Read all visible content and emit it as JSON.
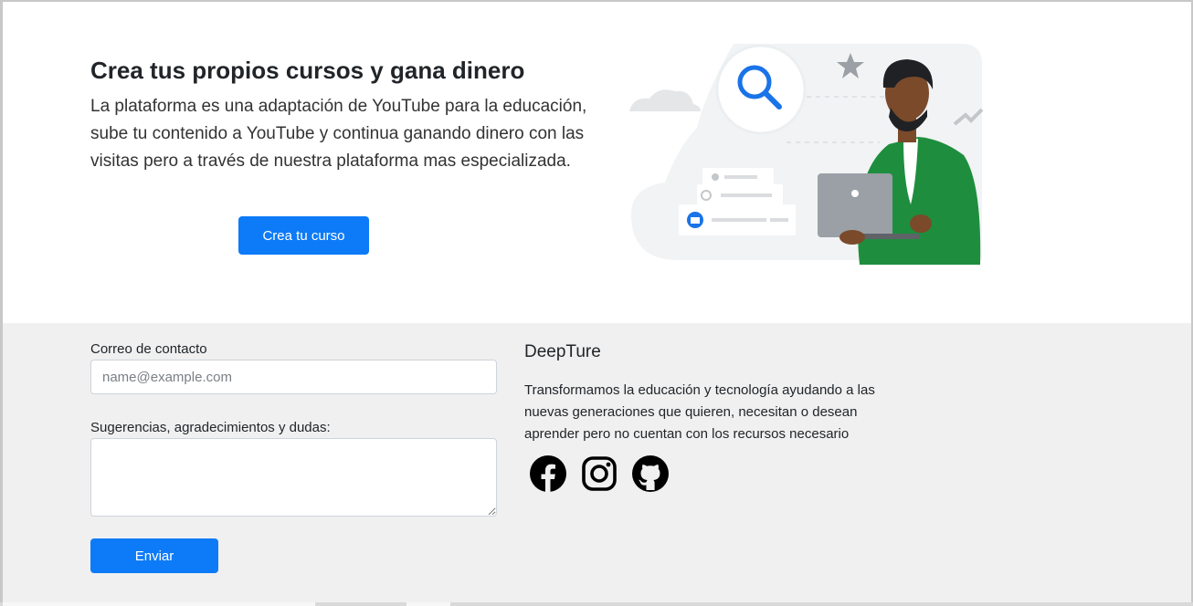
{
  "hero": {
    "title": "Crea tus propios cursos y gana dinero",
    "description": "La plataforma es una adaptación de YouTube para la educación, sube tu contenido a YouTube y continua ganando dinero con las visitas pero a través de nuestra plataforma mas especializada.",
    "button_label": "Crea tu curso"
  },
  "contact_form": {
    "email_label": "Correo de contacto",
    "email_placeholder": "name@example.com",
    "email_value": "",
    "message_label": "Sugerencias, agradecimientos y dudas:",
    "message_value": "",
    "submit_label": "Enviar"
  },
  "about": {
    "brand": "DeepTure",
    "text": "Transformamos la educación y tecnología ayudando a las nuevas generaciones que quieren, necesitan o desean aprender pero no cuentan con los recursos necesario",
    "social": [
      {
        "icon": "facebook-icon"
      },
      {
        "icon": "instagram-icon"
      },
      {
        "icon": "github-icon"
      }
    ]
  },
  "colors": {
    "primary": "#0d7bf7",
    "footer_bg": "#f0f0f0",
    "illustration_green": "#1e8e3e",
    "illustration_blue": "#1a73e8"
  }
}
